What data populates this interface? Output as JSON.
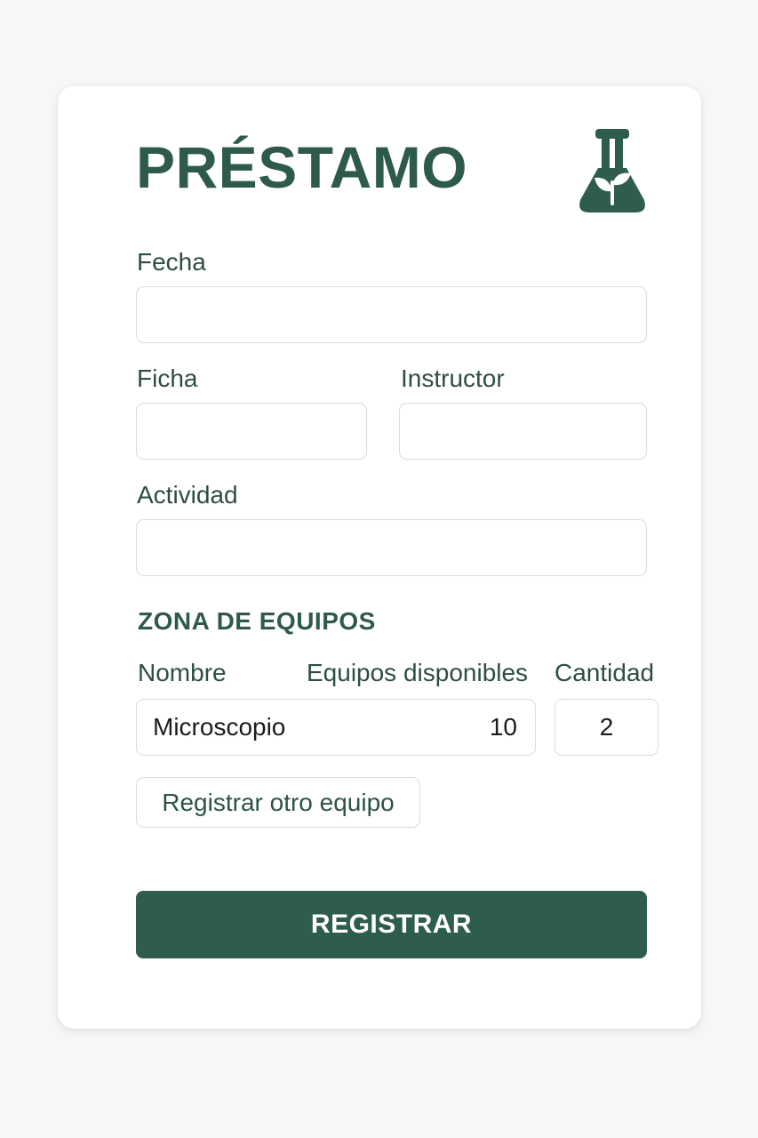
{
  "form": {
    "title": "PRÉSTAMO",
    "logo_icon": "flask-plant-icon",
    "fecha_label": "Fecha",
    "fecha_value": "",
    "ficha_label": "Ficha",
    "ficha_value": "",
    "instructor_label": "Instructor",
    "instructor_value": "",
    "actividad_label": "Actividad",
    "actividad_value": ""
  },
  "equipment": {
    "section_title": "ZONA DE EQUIPOS",
    "col_name": "Nombre",
    "col_available": "Equipos disponibles",
    "col_quantity": "Cantidad",
    "rows": [
      {
        "name": "Microscopio",
        "available": "10",
        "quantity": "2"
      }
    ],
    "add_button_label": "Registrar otro equipo"
  },
  "submit_label": "REGISTRAR",
  "colors": {
    "accent": "#2e5c4f",
    "background": "#f7f7f7",
    "card": "#ffffff"
  }
}
